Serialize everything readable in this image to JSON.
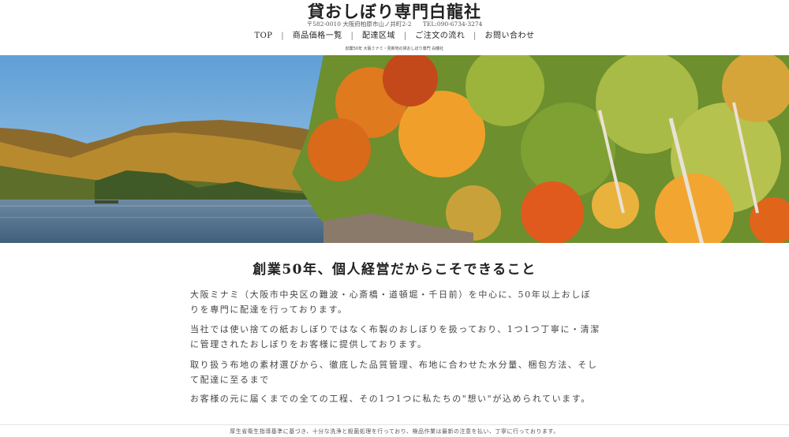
{
  "header": {
    "title": "貸おしぼり専門白龍社",
    "postal_address": "〒582-0010 大阪府柏原市山ノ井町2-2",
    "tel": "TEL:090-6734-3274",
    "tagline": "創業50年 大阪ミナミ・見新地の貸おしぼり専門 白龍社"
  },
  "nav": {
    "items": [
      {
        "label": "TOP"
      },
      {
        "label": "商品価格一覧"
      },
      {
        "label": "配達区域"
      },
      {
        "label": "ご注文の流れ"
      },
      {
        "label": "お問い合わせ"
      }
    ],
    "separator": "|"
  },
  "main": {
    "heading": "創業50年、個人経営だからこそできること",
    "paragraphs": [
      "大阪ミナミ（大阪市中央区の難波・心斎橋・道頓堀・千日前）を中心に、50年以上おしぼりを専門に配達を行っております。",
      "当社では使い捨ての紙おしぼりではなく布製のおしぼりを扱っており、1つ1つ丁寧に・清潔に管理されたおしぼりをお客様に提供しております。",
      "取り扱う布地の素材選びから、徹底した品質管理、布地に合わせた水分量、梱包方法、そして配達に至るまで",
      "お客様の元に届くまでの全ての工程、その1つ1つに私たちの\"想い\"が込められています。"
    ]
  },
  "footer": {
    "text": "厚生省衛生指導基準に基づき、十分な洗浄と殺菌処理を行っており、検品作業は最新の注意を払い、丁寧に行っております。"
  },
  "colors": {
    "sky": "#7fb4de",
    "lake": "#4f6f8c",
    "foliage_orange": "#e07a1e",
    "foliage_green": "#8aa83a"
  }
}
